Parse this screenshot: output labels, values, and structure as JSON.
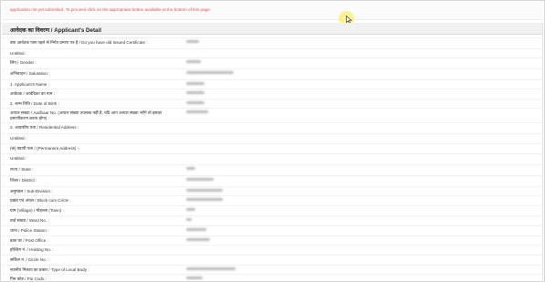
{
  "alert": {
    "message": "application not yet submitted. To proceed click on the appropriate button available at the bottom of this page."
  },
  "section": {
    "title": "आवेदक का विवरण / Applicant's Detail"
  },
  "fields": [
    {
      "label": "क्या आवेदक पास पहले से निर्गत प्रमाण पत्र है / Do you have old Issued Certificate :"
    },
    {
      "label": "Untitled :"
    },
    {
      "label": "लिंग / Gender :"
    },
    {
      "label": "अभिवादन / Salutation :"
    },
    {
      "label": "1. Applicant's Name :"
    },
    {
      "label": "आवेदक / आवेदिका का नाम :"
    },
    {
      "label": "2. जन्म तिथि / Date of Birth :"
    },
    {
      "label": "आधार संख्या / Aadhaar No. (आधार संख्या उपलब्ध नहीं है, यदि आप आधार संख्या भरेंगे तो इसका प्रमाणीकरण करना होगा) :"
    },
    {
      "label": "3. आवासीय पता / Residential Address :"
    },
    {
      "label": "Untitled :"
    },
    {
      "label": "(क) स्थायी पता / (Permanent Address) :-"
    },
    {
      "label": "Untitled :"
    },
    {
      "label": "राज्य / State :"
    },
    {
      "label": "जिला / District :"
    },
    {
      "label": "अनुमंडल / Sub-Division :"
    },
    {
      "label": "प्रखंड एवं अंचल / Block cum Circle :"
    },
    {
      "label": "ग्राम (Village) / मोहल्ला (Town) :"
    },
    {
      "label": "वार्ड संख्या / Ward No. :"
    },
    {
      "label": "थाना / Police Station :"
    },
    {
      "label": "डाक घर / Post Office :"
    },
    {
      "label": "होल्डिंग नं. / Holding No. :"
    },
    {
      "label": "सर्किल नं. / Circle No. :"
    },
    {
      "label": "स्थानीय निकाय का प्रकार / Type of Local Body :"
    },
    {
      "label": "पिन कोड / Pin Code :"
    }
  ]
}
